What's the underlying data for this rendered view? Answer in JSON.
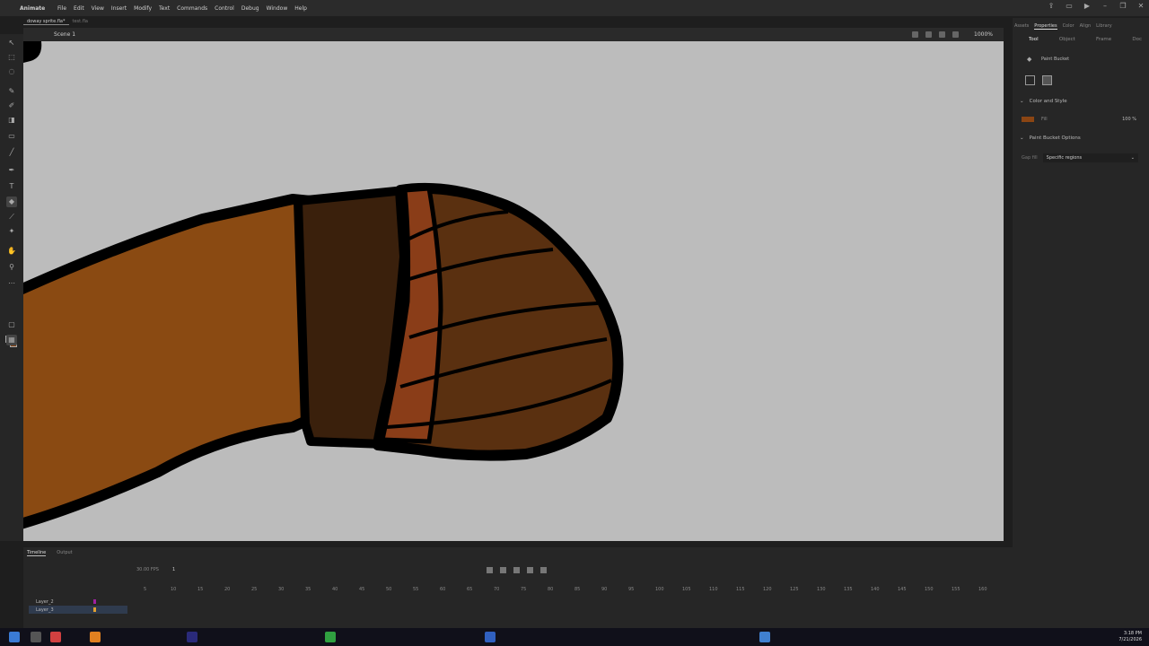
{
  "app": {
    "name": "Animate"
  },
  "menu": [
    "File",
    "Edit",
    "View",
    "Insert",
    "Modify",
    "Text",
    "Commands",
    "Control",
    "Debug",
    "Window",
    "Help"
  ],
  "doc_tabs": [
    {
      "label": "doway sprite.fla*",
      "active": true
    },
    {
      "label": "test.fla",
      "active": false
    }
  ],
  "scene": {
    "label": "Scene 1",
    "zoom": "1000%"
  },
  "right_panel": {
    "top_tabs": [
      "Assets",
      "Properties",
      "Color",
      "Align",
      "Library"
    ],
    "active_top_tab": "Properties",
    "tabs": [
      "Tool",
      "Object",
      "Frame",
      "Doc"
    ],
    "active_tab": "Tool",
    "tool_name": "Paint Bucket",
    "sections": {
      "color_style": "Color and Style",
      "fill_label": "Fill",
      "fill_opacity": "100 %",
      "fill_color": "#8b4513",
      "bucket_options": "Paint Bucket Options",
      "gap_fill_label": "Gap fill",
      "gap_fill_value": "Specific regions"
    }
  },
  "timeline": {
    "tabs": [
      "Timeline",
      "Output"
    ],
    "fps": "30.00 FPS",
    "frame": "1",
    "ruler_ticks": [
      "5",
      "10",
      "15",
      "20",
      "25",
      "30",
      "35",
      "40",
      "45",
      "50",
      "55",
      "60",
      "65",
      "70",
      "75",
      "80",
      "85",
      "90",
      "95",
      "100",
      "105",
      "110",
      "115",
      "120",
      "125",
      "130",
      "135",
      "140",
      "145",
      "150",
      "155",
      "160"
    ],
    "layers": [
      {
        "name": "Layer_2",
        "color": "#a020a0"
      },
      {
        "name": "Layer_3",
        "color": "#e0a030"
      }
    ]
  },
  "taskbar": {
    "time": "3:18 PM",
    "date": "7/21/2026"
  },
  "colors": {
    "arm": "#8a4a12",
    "band": "#3a200c",
    "hand": "#5a3010",
    "stripe": "#8a3d18",
    "outline": "#000000",
    "stage": "#bcbcbc"
  }
}
